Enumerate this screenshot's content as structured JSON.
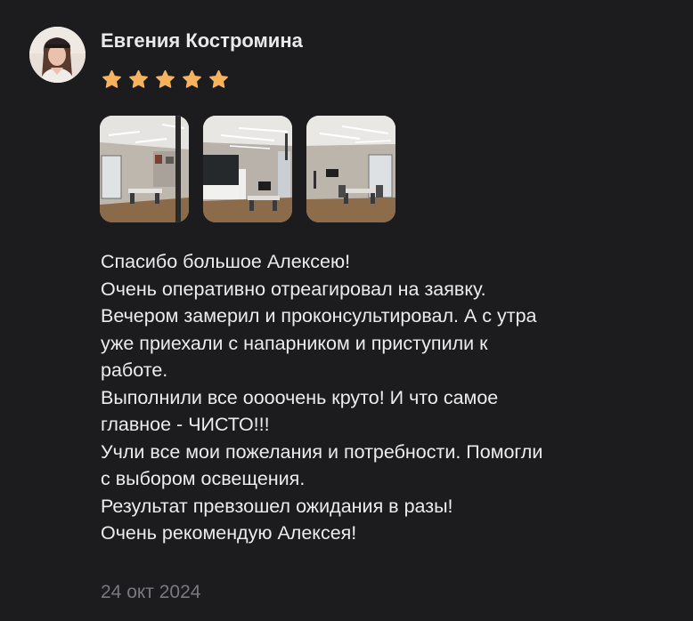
{
  "review": {
    "author": {
      "name": "Евгения Костромина",
      "avatar_icon": "user-photo"
    },
    "rating": {
      "value": 5,
      "max": 5,
      "star_color": "#f6b25c"
    },
    "photos": [
      {
        "name": "interior-photo-1"
      },
      {
        "name": "interior-photo-2"
      },
      {
        "name": "interior-photo-3"
      }
    ],
    "text_lines": [
      "Спасибо большое Алексею!",
      "Очень оперативно отреагировал на заявку.",
      "Вечером замерил и проконсультировал. А с утра",
      "уже приехали с напарником и приступили к",
      "работе.",
      "Выполнили все оооочень круто! И что самое",
      "главное - ЧИСТО!!!",
      "Учли все мои пожелания и потребности. Помогли",
      "с выбором освещения.",
      "Результат превзошел ожидания в разы!",
      "Очень рекомендую Алексея!"
    ],
    "date": "24 окт 2024"
  }
}
